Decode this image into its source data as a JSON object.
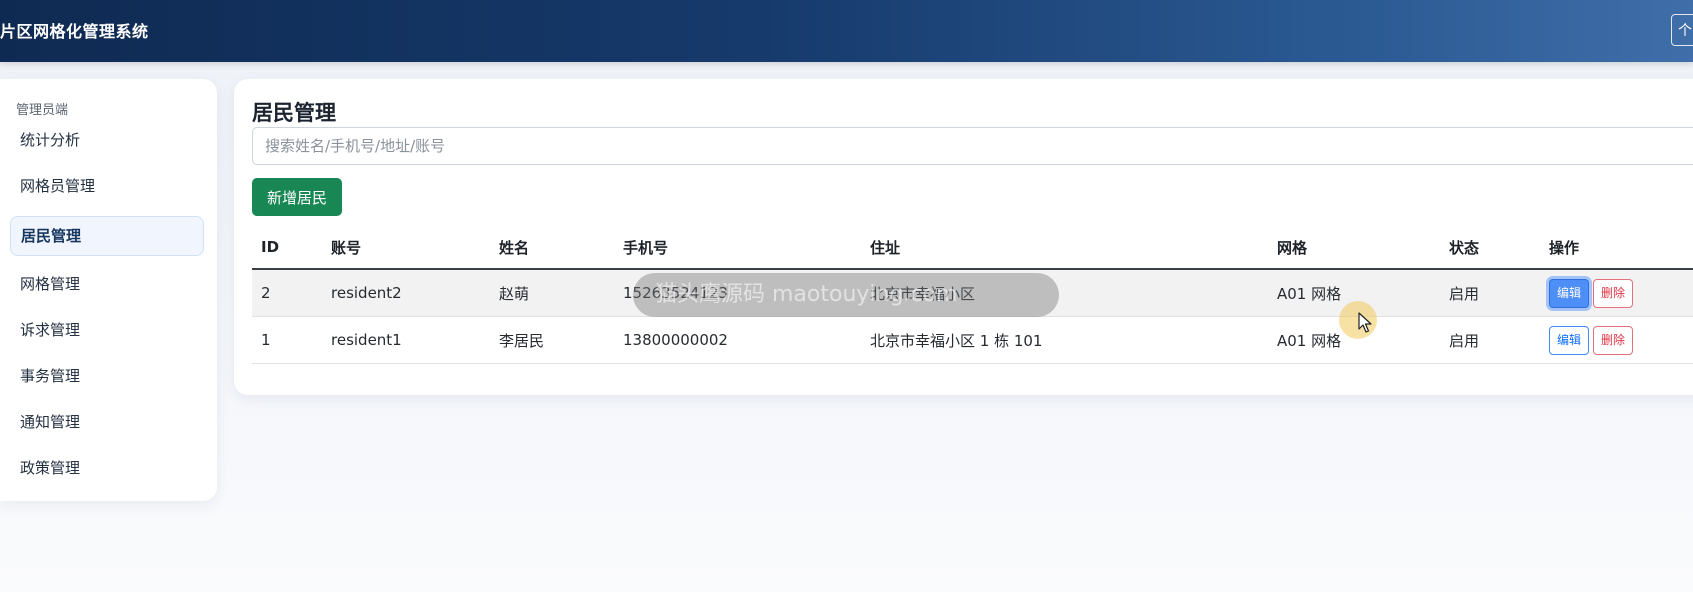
{
  "header": {
    "title": "片区网格化管理系统",
    "right_button_label": "个"
  },
  "sidebar": {
    "section_title": "管理员端",
    "items": [
      {
        "label": "统计分析",
        "active": false
      },
      {
        "label": "网格员管理",
        "active": false
      },
      {
        "label": "居民管理",
        "active": true
      },
      {
        "label": "网格管理",
        "active": false
      },
      {
        "label": "诉求管理",
        "active": false
      },
      {
        "label": "事务管理",
        "active": false
      },
      {
        "label": "通知管理",
        "active": false
      },
      {
        "label": "政策管理",
        "active": false
      }
    ]
  },
  "main": {
    "title": "居民管理",
    "search": {
      "placeholder": "搜索姓名/手机号/地址/账号",
      "value": ""
    },
    "add_button": "新增居民",
    "table": {
      "columns": [
        "ID",
        "账号",
        "姓名",
        "手机号",
        "住址",
        "网格",
        "状态",
        "操作"
      ],
      "rows": [
        {
          "id": "2",
          "account": "resident2",
          "name": "赵萌",
          "phone": "15263524123",
          "address": "北京市幸福小区",
          "grid": "A01 网格",
          "status": "启用",
          "edit": "编辑",
          "delete": "删除"
        },
        {
          "id": "1",
          "account": "resident1",
          "name": "李居民",
          "phone": "13800000002",
          "address": "北京市幸福小区 1 栋 101",
          "grid": "A01 网格",
          "status": "启用",
          "edit": "编辑",
          "delete": "删除"
        }
      ]
    }
  },
  "overlay": {
    "watermark_text": "猫头鹰源码 maotouying.com"
  },
  "colors": {
    "header": "#163a6c",
    "add_button": "#198754",
    "edit": "#0d6efd",
    "delete": "#dc3545"
  }
}
